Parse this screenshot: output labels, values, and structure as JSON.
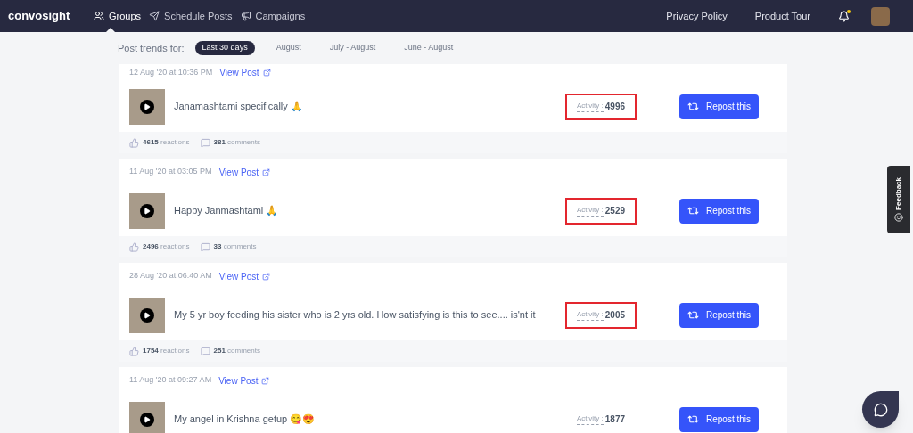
{
  "nav": {
    "brand": "convosight",
    "items": [
      {
        "label": "Groups",
        "selected": true
      },
      {
        "label": "Schedule Posts",
        "selected": false
      },
      {
        "label": "Campaigns",
        "selected": false
      }
    ],
    "links": [
      "Privacy Policy",
      "Product Tour"
    ],
    "notification_dot": true
  },
  "filter": {
    "label": "Post trends for:",
    "options": [
      {
        "label": "Last 30 days",
        "selected": true
      },
      {
        "label": "August",
        "selected": false
      },
      {
        "label": "July - August",
        "selected": false
      },
      {
        "label": "June - August",
        "selected": false
      }
    ]
  },
  "posts": [
    {
      "date": "12 Aug '20 at 10:36 PM",
      "link": "View Post",
      "text": "Janamashtami specifically 🙏",
      "activity_label": "Activity :",
      "activity": "4996",
      "highlighted": true,
      "button": "Repost this",
      "reactions": "4615",
      "reactions_label": "reactions",
      "comments": "381",
      "comments_label": "comments"
    },
    {
      "date": "11 Aug '20 at 03:05 PM",
      "link": "View Post",
      "text": "Happy Janmashtami 🙏",
      "activity_label": "Activity :",
      "activity": "2529",
      "highlighted": true,
      "button": "Repost this",
      "reactions": "2496",
      "reactions_label": "reactions",
      "comments": "33",
      "comments_label": "comments"
    },
    {
      "date": "28 Aug '20 at 06:40 AM",
      "link": "View Post",
      "text": "My 5 yr boy feeding his sister who is 2 yrs old. How satisfying is this to see.... is'nt it",
      "activity_label": "Activity :",
      "activity": "2005",
      "highlighted": true,
      "button": "Repost this",
      "reactions": "1754",
      "reactions_label": "reactions",
      "comments": "251",
      "comments_label": "comments"
    },
    {
      "date": "11 Aug '20 at 09:27 AM",
      "link": "View Post",
      "text": "My angel in Krishna getup 😋😍",
      "activity_label": "Activity :",
      "activity": "1877",
      "highlighted": false,
      "button": "Repost this"
    }
  ],
  "feedback": "Feedback"
}
